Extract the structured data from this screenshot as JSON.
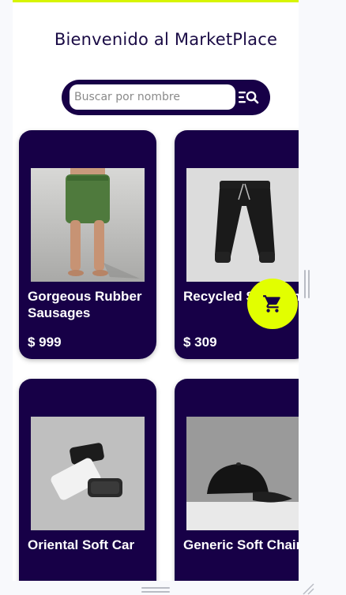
{
  "header": {
    "title": "Bienvenido al MarketPlace"
  },
  "search": {
    "placeholder": "Buscar por nombre",
    "value": "",
    "icon": "filter-search-icon"
  },
  "products": [
    {
      "name": "Gorgeous Rubber Sausages",
      "price": "$ 999",
      "image": "green-shorts"
    },
    {
      "name": "Recycled Soft Pants",
      "price": "$ 309",
      "image": "black-joggers"
    },
    {
      "name": "Oriental Soft Car",
      "price": "",
      "image": "phone-and-powerbanks"
    },
    {
      "name": "Generic Soft Chair",
      "price": "",
      "image": "black-cap"
    }
  ],
  "cart_button": {
    "icon": "shopping-cart-icon"
  },
  "colors": {
    "primary": "#170047",
    "accent": "#e2ff00",
    "background": "#ffffff",
    "text_on_card": "#ffffff"
  }
}
